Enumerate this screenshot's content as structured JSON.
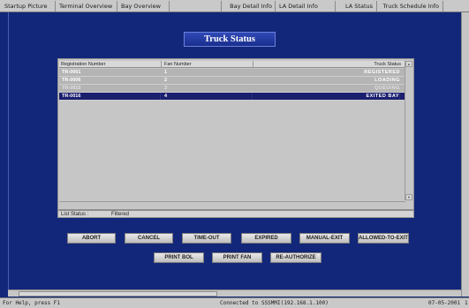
{
  "nav": {
    "tabs": [
      {
        "label": "Startup Picture"
      },
      {
        "label": "Terminal Overview"
      },
      {
        "label": "Bay Overview"
      },
      {
        "label": "Bay Detail Info"
      },
      {
        "label": "LA Detail Info"
      },
      {
        "label": "LA Status"
      },
      {
        "label": "Truck Schedule Info"
      }
    ]
  },
  "page": {
    "title": "Truck Status"
  },
  "table": {
    "columns": [
      "Registration Number",
      "Fan Number",
      "Truck Status"
    ],
    "rows": [
      {
        "reg": "TR-0001",
        "fan": "1",
        "status": "REGISTERED"
      },
      {
        "reg": "TR-0006",
        "fan": "2",
        "status": "LOADING"
      },
      {
        "reg": "TR-0015",
        "fan": "3",
        "status": "QUEUING"
      },
      {
        "reg": "TR-0016",
        "fan": "4",
        "status": "EXITED  BAY"
      }
    ],
    "selected_row": 3
  },
  "list_status": {
    "label": "List Status :",
    "value": "Filtered"
  },
  "actions": {
    "abort": "ABORT",
    "cancel": "CANCEL",
    "time_out": "TIME-OUT",
    "expired": "EXPIRED",
    "manual_exit": "MANUAL-EXIT",
    "allowed_to_exit": "ALLOWED-TO-EXIT",
    "print_bol": "PRINT BOL",
    "print_fan": "PRINT FAN",
    "re_authorize": "RE-AUTHORIZE"
  },
  "statusbar": {
    "help": "For Help, press F1",
    "connection": "Connected  to  SSSMMI(192.168.1.100)",
    "date": "07-05-2001",
    "page": "1"
  },
  "colors": {
    "background": "#13277a",
    "selected_row": "#1a1f6e",
    "panel": "#c6c6c6"
  }
}
